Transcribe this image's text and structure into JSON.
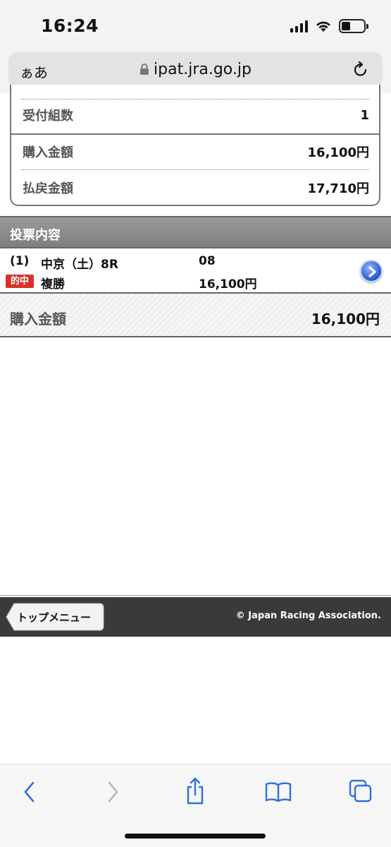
{
  "status_bar": {
    "time": "16:24"
  },
  "browser": {
    "aa_label": "ぁあ",
    "url": "ipat.jra.go.jp"
  },
  "summary": {
    "rows": [
      {
        "label": "受付組数",
        "value": "1"
      },
      {
        "label": "購入金額",
        "value": "16,100円"
      },
      {
        "label": "払戻金額",
        "value": "17,710円"
      }
    ]
  },
  "section": {
    "title": "投票内容"
  },
  "bet": {
    "number": "(1)",
    "race": "中京（土）8R",
    "horse": "08",
    "badge": "的中",
    "type": "複勝",
    "amount": "16,100円"
  },
  "total": {
    "label": "購入金額",
    "value": "16,100円"
  },
  "footer": {
    "top_menu": "トップメニュー",
    "copyright": "© Japan Racing Association."
  },
  "colors": {
    "accent_blue": "#2f6fe0",
    "badge_red": "#d9322c",
    "header_gray": "#8a8a8a",
    "footer_dark": "#3a3a3a"
  },
  "icons": {
    "status": [
      "signal-icon",
      "wifi-icon",
      "battery-icon"
    ],
    "address": [
      "lock-icon",
      "reload-icon"
    ],
    "toolbar": [
      "back-icon",
      "forward-icon",
      "share-icon",
      "bookmarks-icon",
      "tabs-icon"
    ]
  }
}
